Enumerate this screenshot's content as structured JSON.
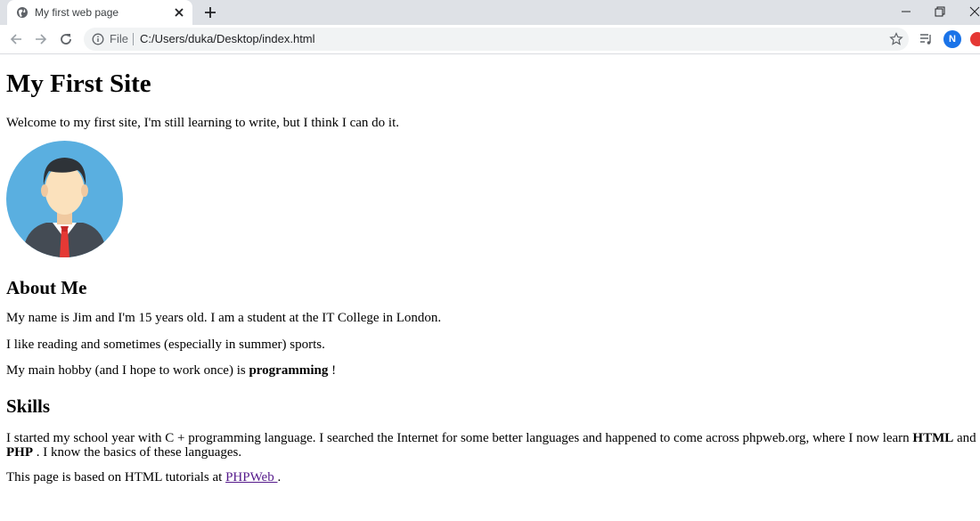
{
  "browser": {
    "tab_title": "My first web page",
    "scheme_label": "File",
    "url": "C:/Users/duka/Desktop/index.html",
    "profile_initial": "N"
  },
  "content": {
    "heading": "My First Site",
    "welcome": "Welcome to my first site, I'm still learning to write, but I think I can do it.",
    "about_heading": "About Me",
    "about_p1": "My name is Jim and I'm 15 years old. I am a student at the IT College in London.",
    "about_p2": "I like reading and sometimes (especially in summer) sports.",
    "hobby_pre": "My main hobby (and I hope to work once) is ",
    "hobby_bold": "programming",
    "hobby_post": " !",
    "skills_heading": "Skills",
    "skills_pre": "I started my school year with C + programming language. I searched the Internet for some better languages and happened to come across phpweb.org, where I now learn ",
    "skills_html": "HTML",
    "skills_and": " and ",
    "skills_php": "PHP",
    "skills_post": " . I know the basics of these languages.",
    "footer_pre": "This page is based on HTML tutorials at ",
    "footer_link": "PHPWeb ",
    "footer_post": "."
  },
  "icons": {
    "tab_favicon": "globe-icon",
    "avatar": "person-avatar-icon"
  },
  "colors": {
    "avatar_bg": "#5aafe0",
    "link": "#551a8b",
    "profile": "#1a73e8"
  }
}
